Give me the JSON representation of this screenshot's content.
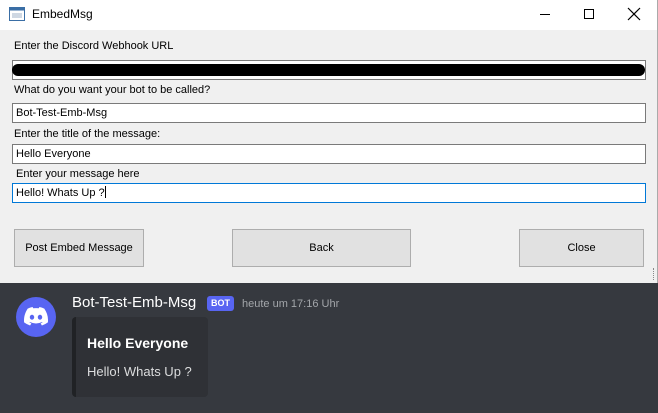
{
  "window": {
    "title": "EmbedMsg",
    "webhook_label": "Enter the Discord Webhook URL",
    "botname_label": "What do you want your bot to be called?",
    "botname_value": "Bot-Test-Emb-Msg",
    "msgtitle_label": "Enter the title of the message:",
    "msgtitle_value": "Hello Everyone",
    "message_label": "Enter your message here",
    "message_value": "Hello! Whats Up ?",
    "buttons": {
      "post": "Post Embed Message",
      "back": "Back",
      "close": "Close"
    }
  },
  "discord": {
    "username": "Bot-Test-Emb-Msg",
    "bot_tag": "BOT",
    "timestamp": "heute um 17:16 Uhr",
    "embed_title": "Hello Everyone",
    "embed_description": "Hello! Whats Up ?"
  },
  "icons": {
    "app": "winforms-app-icon",
    "avatar": "discord-logo-icon"
  },
  "colors": {
    "discord_blurple": "#5865f2",
    "discord_bg": "#36393f",
    "embed_bg": "#2f3136",
    "focus_border": "#0078d7"
  }
}
